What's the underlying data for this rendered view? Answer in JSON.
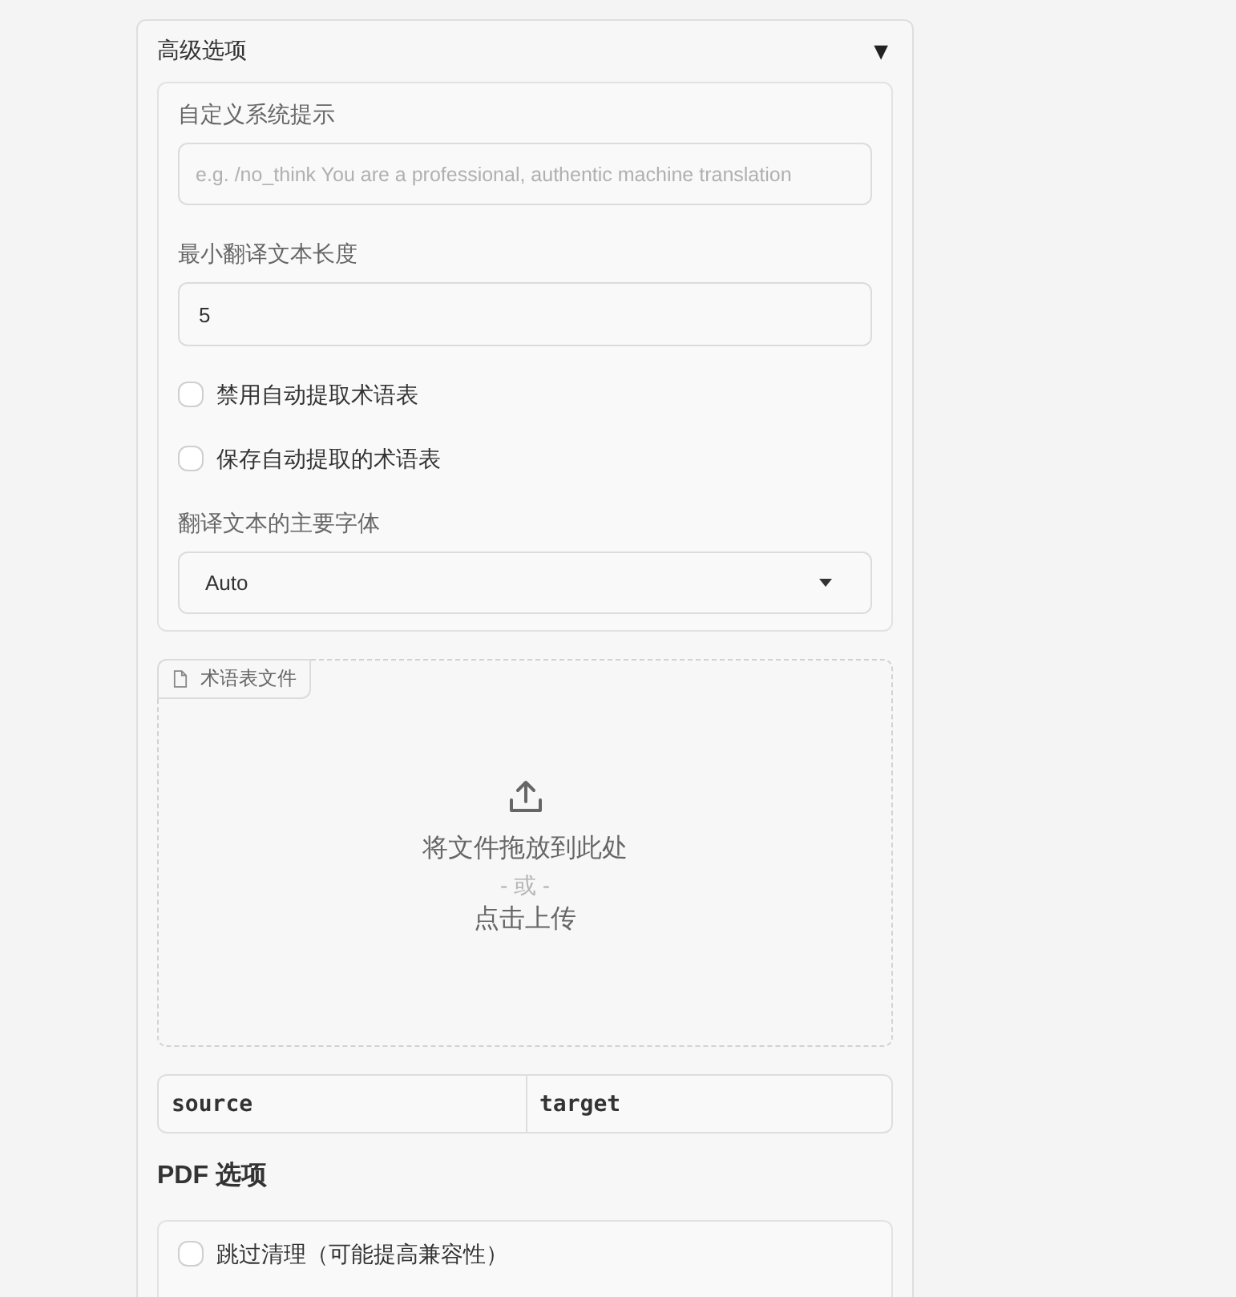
{
  "accordion": {
    "title": "高级选项",
    "toggle_icon": "▼",
    "expanded": true,
    "fields": [
      {
        "kind": "textarea",
        "label": "自定义系统提示",
        "placeholder": "e.g. /no_think You are a professional, authentic machine translation"
      },
      {
        "kind": "text",
        "label": "最小翻译文本长度",
        "value": "5"
      },
      {
        "kind": "checkbox",
        "label": "禁用自动提取术语表",
        "checked": false
      },
      {
        "kind": "checkbox",
        "label": "保存自动提取的术语表",
        "checked": false
      },
      {
        "kind": "dropdown",
        "label": "翻译文本的主要字体",
        "value": "Auto"
      }
    ],
    "glossary_upload": {
      "label": "术语表文件",
      "drop_text": "将文件拖放到此处",
      "or_text": "- 或 -",
      "click_text": "点击上传"
    },
    "glossary_table": {
      "columns": [
        "source",
        "target"
      ]
    },
    "pdf_options": {
      "title": "PDF 选项",
      "fields": [
        {
          "kind": "checkbox",
          "label": "跳过清理（可能提高兼容性）",
          "checked": false
        }
      ]
    }
  }
}
